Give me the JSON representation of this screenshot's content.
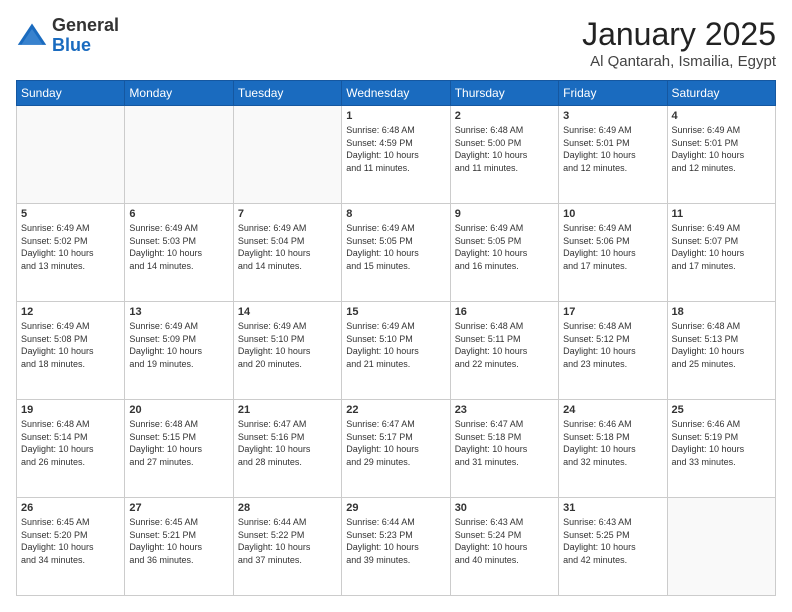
{
  "logo": {
    "general": "General",
    "blue": "Blue"
  },
  "title": {
    "month": "January 2025",
    "location": "Al Qantarah, Ismailia, Egypt"
  },
  "headers": [
    "Sunday",
    "Monday",
    "Tuesday",
    "Wednesday",
    "Thursday",
    "Friday",
    "Saturday"
  ],
  "weeks": [
    [
      {
        "day": "",
        "info": ""
      },
      {
        "day": "",
        "info": ""
      },
      {
        "day": "",
        "info": ""
      },
      {
        "day": "1",
        "info": "Sunrise: 6:48 AM\nSunset: 4:59 PM\nDaylight: 10 hours\nand 11 minutes."
      },
      {
        "day": "2",
        "info": "Sunrise: 6:48 AM\nSunset: 5:00 PM\nDaylight: 10 hours\nand 11 minutes."
      },
      {
        "day": "3",
        "info": "Sunrise: 6:49 AM\nSunset: 5:01 PM\nDaylight: 10 hours\nand 12 minutes."
      },
      {
        "day": "4",
        "info": "Sunrise: 6:49 AM\nSunset: 5:01 PM\nDaylight: 10 hours\nand 12 minutes."
      }
    ],
    [
      {
        "day": "5",
        "info": "Sunrise: 6:49 AM\nSunset: 5:02 PM\nDaylight: 10 hours\nand 13 minutes."
      },
      {
        "day": "6",
        "info": "Sunrise: 6:49 AM\nSunset: 5:03 PM\nDaylight: 10 hours\nand 14 minutes."
      },
      {
        "day": "7",
        "info": "Sunrise: 6:49 AM\nSunset: 5:04 PM\nDaylight: 10 hours\nand 14 minutes."
      },
      {
        "day": "8",
        "info": "Sunrise: 6:49 AM\nSunset: 5:05 PM\nDaylight: 10 hours\nand 15 minutes."
      },
      {
        "day": "9",
        "info": "Sunrise: 6:49 AM\nSunset: 5:05 PM\nDaylight: 10 hours\nand 16 minutes."
      },
      {
        "day": "10",
        "info": "Sunrise: 6:49 AM\nSunset: 5:06 PM\nDaylight: 10 hours\nand 17 minutes."
      },
      {
        "day": "11",
        "info": "Sunrise: 6:49 AM\nSunset: 5:07 PM\nDaylight: 10 hours\nand 17 minutes."
      }
    ],
    [
      {
        "day": "12",
        "info": "Sunrise: 6:49 AM\nSunset: 5:08 PM\nDaylight: 10 hours\nand 18 minutes."
      },
      {
        "day": "13",
        "info": "Sunrise: 6:49 AM\nSunset: 5:09 PM\nDaylight: 10 hours\nand 19 minutes."
      },
      {
        "day": "14",
        "info": "Sunrise: 6:49 AM\nSunset: 5:10 PM\nDaylight: 10 hours\nand 20 minutes."
      },
      {
        "day": "15",
        "info": "Sunrise: 6:49 AM\nSunset: 5:10 PM\nDaylight: 10 hours\nand 21 minutes."
      },
      {
        "day": "16",
        "info": "Sunrise: 6:48 AM\nSunset: 5:11 PM\nDaylight: 10 hours\nand 22 minutes."
      },
      {
        "day": "17",
        "info": "Sunrise: 6:48 AM\nSunset: 5:12 PM\nDaylight: 10 hours\nand 23 minutes."
      },
      {
        "day": "18",
        "info": "Sunrise: 6:48 AM\nSunset: 5:13 PM\nDaylight: 10 hours\nand 25 minutes."
      }
    ],
    [
      {
        "day": "19",
        "info": "Sunrise: 6:48 AM\nSunset: 5:14 PM\nDaylight: 10 hours\nand 26 minutes."
      },
      {
        "day": "20",
        "info": "Sunrise: 6:48 AM\nSunset: 5:15 PM\nDaylight: 10 hours\nand 27 minutes."
      },
      {
        "day": "21",
        "info": "Sunrise: 6:47 AM\nSunset: 5:16 PM\nDaylight: 10 hours\nand 28 minutes."
      },
      {
        "day": "22",
        "info": "Sunrise: 6:47 AM\nSunset: 5:17 PM\nDaylight: 10 hours\nand 29 minutes."
      },
      {
        "day": "23",
        "info": "Sunrise: 6:47 AM\nSunset: 5:18 PM\nDaylight: 10 hours\nand 31 minutes."
      },
      {
        "day": "24",
        "info": "Sunrise: 6:46 AM\nSunset: 5:18 PM\nDaylight: 10 hours\nand 32 minutes."
      },
      {
        "day": "25",
        "info": "Sunrise: 6:46 AM\nSunset: 5:19 PM\nDaylight: 10 hours\nand 33 minutes."
      }
    ],
    [
      {
        "day": "26",
        "info": "Sunrise: 6:45 AM\nSunset: 5:20 PM\nDaylight: 10 hours\nand 34 minutes."
      },
      {
        "day": "27",
        "info": "Sunrise: 6:45 AM\nSunset: 5:21 PM\nDaylight: 10 hours\nand 36 minutes."
      },
      {
        "day": "28",
        "info": "Sunrise: 6:44 AM\nSunset: 5:22 PM\nDaylight: 10 hours\nand 37 minutes."
      },
      {
        "day": "29",
        "info": "Sunrise: 6:44 AM\nSunset: 5:23 PM\nDaylight: 10 hours\nand 39 minutes."
      },
      {
        "day": "30",
        "info": "Sunrise: 6:43 AM\nSunset: 5:24 PM\nDaylight: 10 hours\nand 40 minutes."
      },
      {
        "day": "31",
        "info": "Sunrise: 6:43 AM\nSunset: 5:25 PM\nDaylight: 10 hours\nand 42 minutes."
      },
      {
        "day": "",
        "info": ""
      }
    ]
  ]
}
